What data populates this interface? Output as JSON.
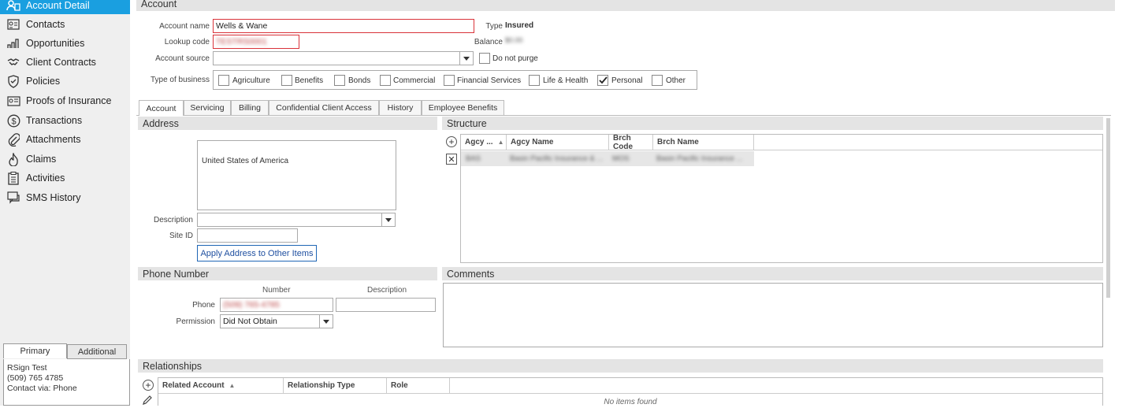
{
  "sidebar": {
    "items": [
      {
        "label": "Account Detail",
        "icon": "account-detail-icon"
      },
      {
        "label": "Contacts",
        "icon": "contacts-icon"
      },
      {
        "label": "Opportunities",
        "icon": "opportunities-icon"
      },
      {
        "label": "Client Contracts",
        "icon": "handshake-icon"
      },
      {
        "label": "Policies",
        "icon": "shield-check-icon"
      },
      {
        "label": "Proofs of Insurance",
        "icon": "certificate-icon"
      },
      {
        "label": "Transactions",
        "icon": "dollar-icon"
      },
      {
        "label": "Attachments",
        "icon": "paperclip-icon"
      },
      {
        "label": "Claims",
        "icon": "flame-icon"
      },
      {
        "label": "Activities",
        "icon": "clipboard-icon"
      },
      {
        "label": "SMS History",
        "icon": "chat-icon"
      }
    ],
    "contact_tabs": [
      "Primary",
      "Additional"
    ],
    "contact": {
      "name": "RSign Test",
      "phone": "(509) 765 4785",
      "via": "Contact via: Phone"
    }
  },
  "header": {
    "title": "Account"
  },
  "account": {
    "name_label": "Account name",
    "name_value": "Wells & Wane",
    "lookup_label": "Lookup code",
    "lookup_value": "TESTRS0001",
    "source_label": "Account source",
    "source_value": "",
    "type_label": "Type",
    "type_value": "Insured",
    "balance_label": "Balance",
    "balance_value": "$0.00",
    "do_not_purge_label": "Do not purge",
    "business_label": "Type of business",
    "business_types": [
      {
        "label": "Agriculture",
        "checked": false
      },
      {
        "label": "Benefits",
        "checked": false
      },
      {
        "label": "Bonds",
        "checked": false
      },
      {
        "label": "Commercial",
        "checked": false
      },
      {
        "label": "Financial Services",
        "checked": false
      },
      {
        "label": "Life & Health",
        "checked": false
      },
      {
        "label": "Personal",
        "checked": true
      },
      {
        "label": "Other",
        "checked": false
      }
    ]
  },
  "tabs": [
    "Account",
    "Servicing",
    "Billing",
    "Confidential Client Access",
    "History",
    "Employee Benefits"
  ],
  "address": {
    "title": "Address",
    "text": "United States of America",
    "description_label": "Description",
    "siteid_label": "Site ID",
    "apply_button": "Apply Address to Other Items"
  },
  "structure": {
    "title": "Structure",
    "columns": [
      "Agcy ...",
      "Agcy Name",
      "Brch Code",
      "Brch Name"
    ],
    "rows": [
      [
        "BAS",
        "Basin Pacific Insurance & ...",
        "MOS",
        "Basin Pacific Insurance ..."
      ]
    ]
  },
  "phone": {
    "title": "Phone Number",
    "number_header": "Number",
    "description_header": "Description",
    "phone_label": "Phone",
    "phone_value": "(509) 765-4785",
    "permission_label": "Permission",
    "permission_value": "Did Not Obtain"
  },
  "comments": {
    "title": "Comments"
  },
  "relationships": {
    "title": "Relationships",
    "columns": [
      "Related Account",
      "Relationship Type",
      "Role"
    ],
    "empty_text": "No items found"
  }
}
